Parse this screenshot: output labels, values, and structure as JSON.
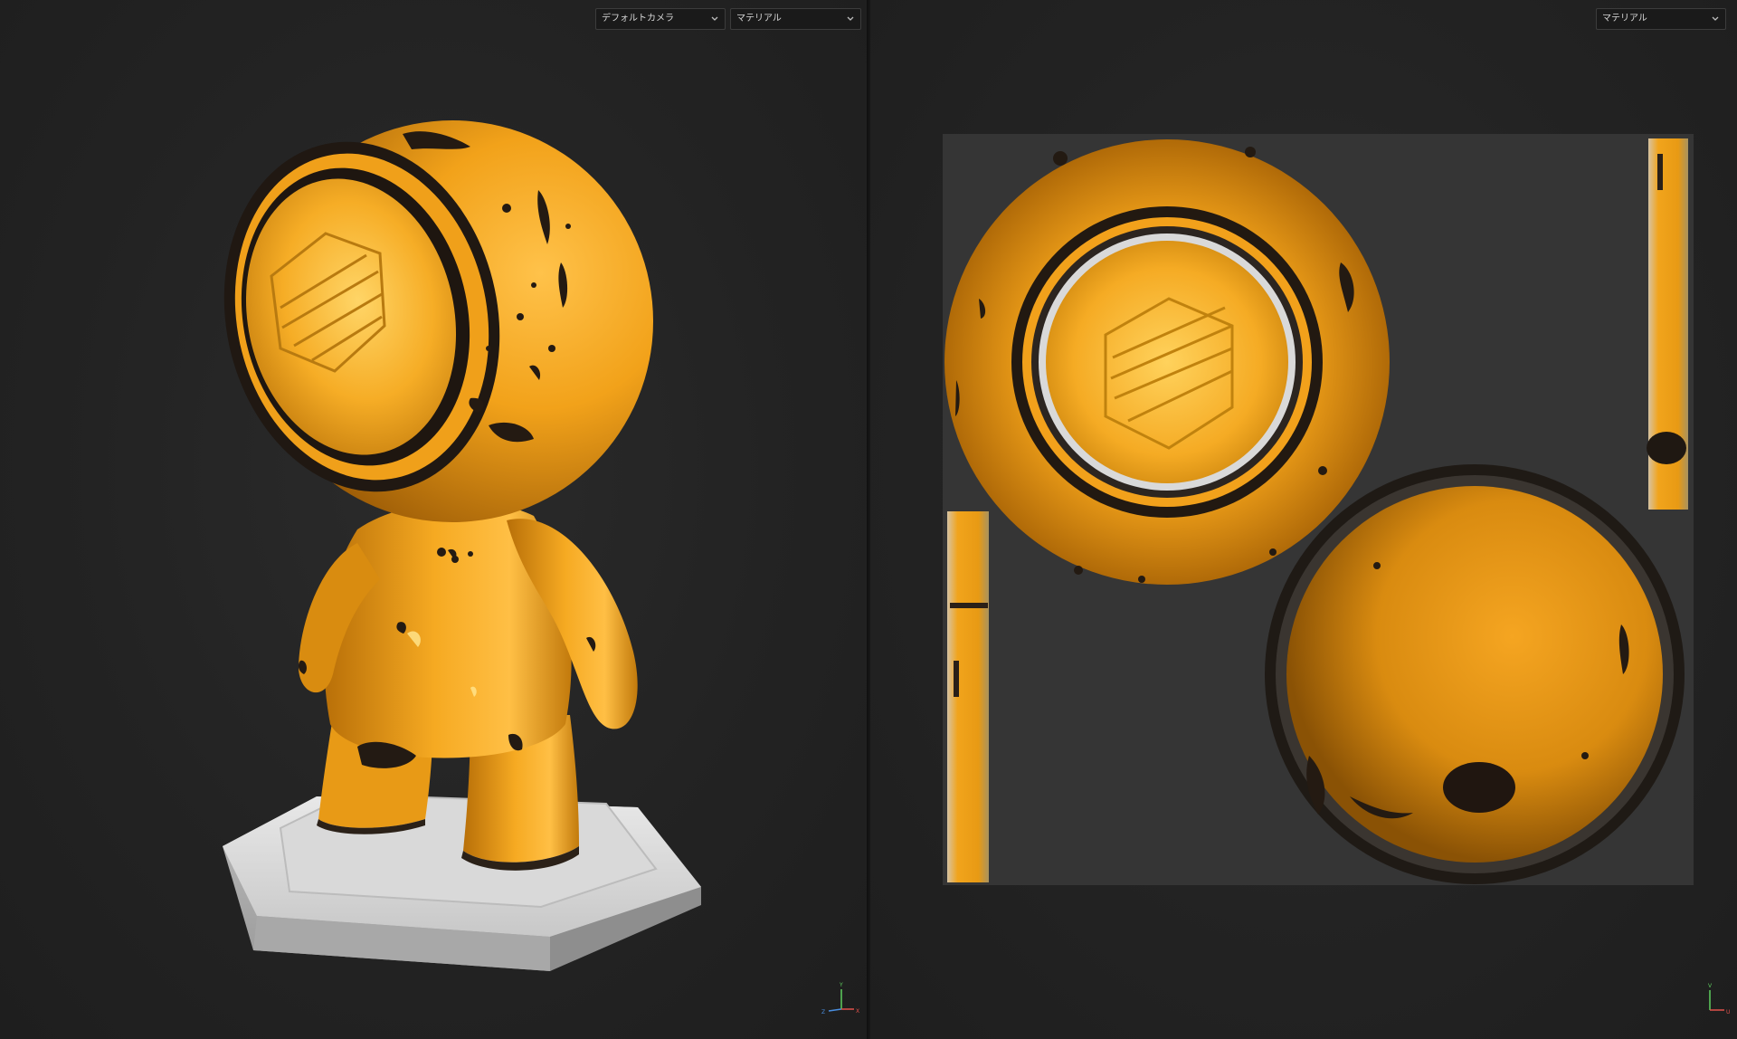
{
  "viewport3d": {
    "camera_dropdown": "デフォルトカメラ",
    "channel_dropdown": "マテリアル",
    "axis_labels": {
      "up": "Y",
      "left": "Z",
      "right": "X"
    }
  },
  "viewport2d": {
    "channel_dropdown": "マテリアル",
    "axis_labels": {
      "up": "V",
      "right": "U"
    }
  },
  "colors": {
    "background": "#232323",
    "paint_orange": "#f0a014",
    "rust_dark": "#1f1812",
    "pedestal_gray": "#d4d4d4",
    "uv_canvas": "#353535",
    "axis_y": "#5fce5f",
    "axis_x": "#e0504a",
    "axis_z": "#4a8ee0"
  }
}
